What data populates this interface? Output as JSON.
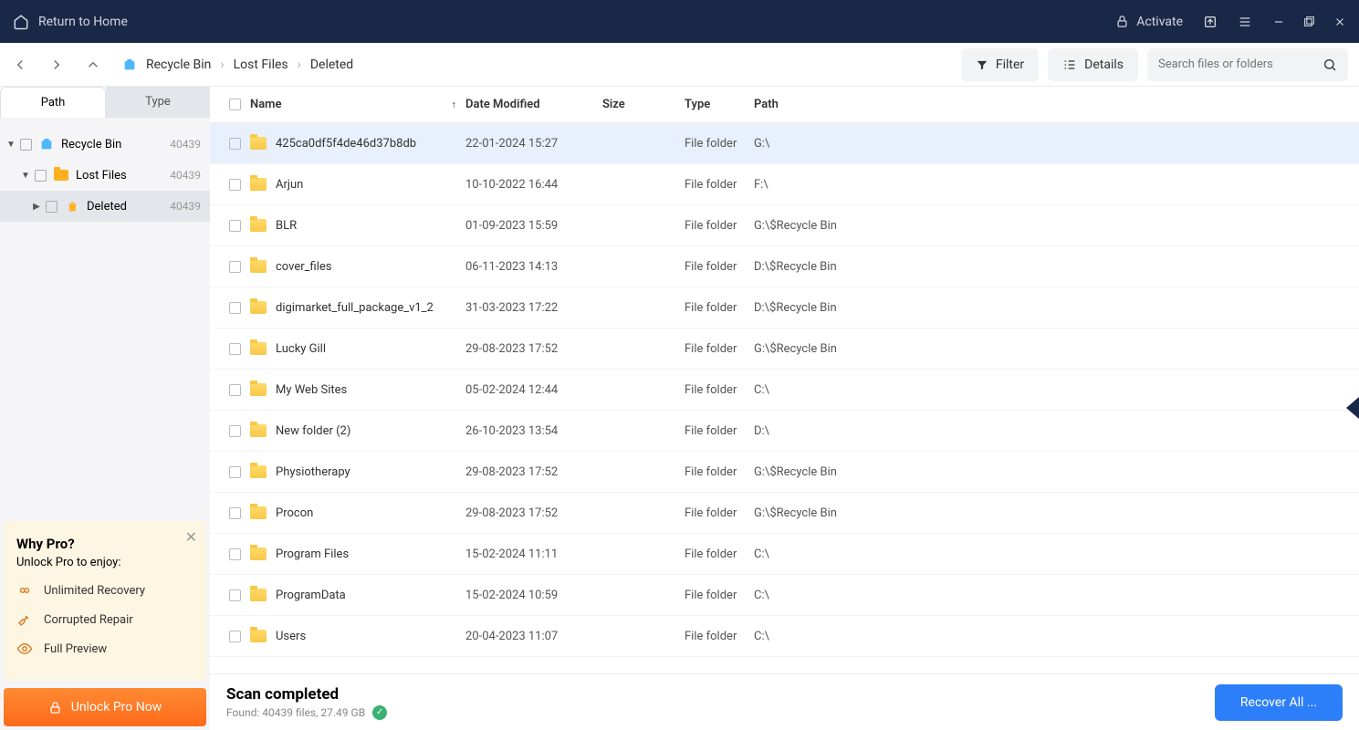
{
  "titlebar": {
    "return_home": "Return to Home",
    "activate": "Activate"
  },
  "toolbar": {
    "filter": "Filter",
    "details": "Details",
    "search_placeholder": "Search files or folders"
  },
  "breadcrumb": [
    "Recycle Bin",
    "Lost Files",
    "Deleted"
  ],
  "sidebar": {
    "tab_path": "Path",
    "tab_type": "Type",
    "tree": [
      {
        "label": "Recycle Bin",
        "count": "40439",
        "indent": 6,
        "toggle": "▼",
        "icon": "recycle"
      },
      {
        "label": "Lost Files",
        "count": "40439",
        "indent": 22,
        "toggle": "▼",
        "icon": "folder-orange"
      },
      {
        "label": "Deleted",
        "count": "40439",
        "indent": 34,
        "toggle": "▶",
        "icon": "trash",
        "selected": true
      }
    ]
  },
  "promo": {
    "title": "Why Pro?",
    "subtitle": "Unlock Pro to enjoy:",
    "features": [
      {
        "icon": "infinity",
        "label": "Unlimited Recovery"
      },
      {
        "icon": "wrench",
        "label": "Corrupted Repair"
      },
      {
        "icon": "eye",
        "label": "Full Preview"
      }
    ],
    "button": "Unlock Pro Now"
  },
  "columns": {
    "name": "Name",
    "date": "Date Modified",
    "size": "Size",
    "type": "Type",
    "path": "Path"
  },
  "rows": [
    {
      "name": "425ca0df5f4de46d37b8db",
      "date": "22-01-2024 15:27",
      "size": "",
      "type": "File folder",
      "path": "G:\\",
      "selected": true
    },
    {
      "name": "Arjun",
      "date": "10-10-2022 16:44",
      "size": "",
      "type": "File folder",
      "path": "F:\\"
    },
    {
      "name": "BLR",
      "date": "01-09-2023 15:59",
      "size": "",
      "type": "File folder",
      "path": "G:\\$Recycle Bin"
    },
    {
      "name": "cover_files",
      "date": "06-11-2023 14:13",
      "size": "",
      "type": "File folder",
      "path": "D:\\$Recycle Bin"
    },
    {
      "name": "digimarket_full_package_v1_2",
      "date": "31-03-2023 17:22",
      "size": "",
      "type": "File folder",
      "path": "D:\\$Recycle Bin"
    },
    {
      "name": "Lucky Gill",
      "date": "29-08-2023 17:52",
      "size": "",
      "type": "File folder",
      "path": "G:\\$Recycle Bin"
    },
    {
      "name": "My Web Sites",
      "date": "05-02-2024 12:44",
      "size": "",
      "type": "File folder",
      "path": "C:\\"
    },
    {
      "name": "New folder (2)",
      "date": "26-10-2023 13:54",
      "size": "",
      "type": "File folder",
      "path": "D:\\"
    },
    {
      "name": "Physiotherapy",
      "date": "29-08-2023 17:52",
      "size": "",
      "type": "File folder",
      "path": "G:\\$Recycle Bin"
    },
    {
      "name": "Procon",
      "date": "29-08-2023 17:52",
      "size": "",
      "type": "File folder",
      "path": "G:\\$Recycle Bin"
    },
    {
      "name": "Program Files",
      "date": "15-02-2024 11:11",
      "size": "",
      "type": "File folder",
      "path": "C:\\"
    },
    {
      "name": "ProgramData",
      "date": "15-02-2024 10:59",
      "size": "",
      "type": "File folder",
      "path": "C:\\"
    },
    {
      "name": "Users",
      "date": "20-04-2023 11:07",
      "size": "",
      "type": "File folder",
      "path": "C:\\"
    }
  ],
  "footer": {
    "title": "Scan completed",
    "subtitle": "Found: 40439 files, 27.49 GB",
    "recover": "Recover All ..."
  }
}
